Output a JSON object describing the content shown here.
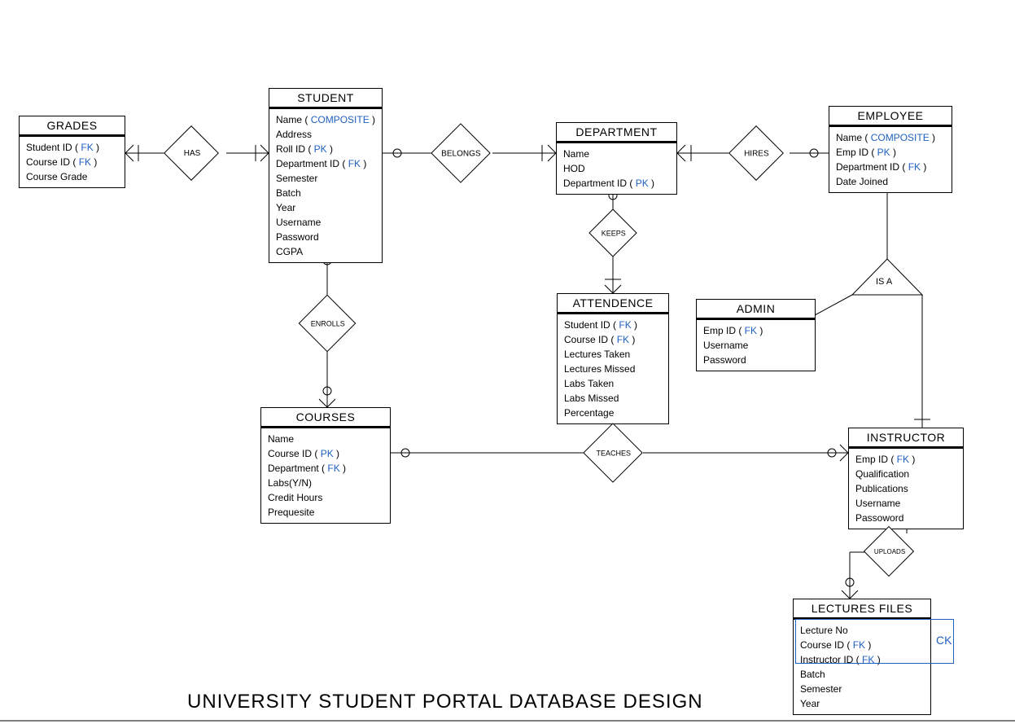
{
  "title": "UNIVERSITY STUDENT PORTAL DATABASE DESIGN",
  "entities": {
    "grades": {
      "name": "GRADES",
      "attrs": [
        {
          "text": "Student ID ( ",
          "key": "FK",
          "suffix": " )"
        },
        {
          "text": "Course ID ( ",
          "key": "FK",
          "suffix": " )"
        },
        {
          "text": "Course Grade"
        }
      ]
    },
    "student": {
      "name": "STUDENT",
      "attrs": [
        {
          "text": "Name ( ",
          "key": "COMPOSITE",
          "suffix": " )"
        },
        {
          "text": "Address"
        },
        {
          "text": "Roll ID ( ",
          "key": "PK",
          "suffix": " )"
        },
        {
          "text": "Department ID ( ",
          "key": "FK",
          "suffix": " )"
        },
        {
          "text": "Semester"
        },
        {
          "text": "Batch"
        },
        {
          "text": "Year"
        },
        {
          "text": "Username"
        },
        {
          "text": "Password"
        },
        {
          "text": "CGPA"
        }
      ]
    },
    "department": {
      "name": "DEPARTMENT",
      "attrs": [
        {
          "text": "Name"
        },
        {
          "text": "HOD"
        },
        {
          "text": "Department ID ( ",
          "key": "PK",
          "suffix": " )"
        }
      ]
    },
    "employee": {
      "name": "EMPLOYEE",
      "attrs": [
        {
          "text": "Name ( ",
          "key": "COMPOSITE",
          "suffix": " )"
        },
        {
          "text": "Emp ID ( ",
          "key": "PK",
          "suffix": " )"
        },
        {
          "text": "Department ID ( ",
          "key": "FK",
          "suffix": " )"
        },
        {
          "text": "Date Joined"
        }
      ]
    },
    "attendence": {
      "name": "ATTENDENCE",
      "attrs": [
        {
          "text": "Student ID ( ",
          "key": "FK",
          "suffix": " )"
        },
        {
          "text": "Course ID ( ",
          "key": "FK",
          "suffix": " )"
        },
        {
          "text": "Lectures Taken"
        },
        {
          "text": "Lectures Missed"
        },
        {
          "text": "Labs Taken"
        },
        {
          "text": "Labs Missed"
        },
        {
          "text": "Percentage"
        }
      ]
    },
    "admin": {
      "name": "ADMIN",
      "attrs": [
        {
          "text": "Emp ID ( ",
          "key": "FK",
          "suffix": " )"
        },
        {
          "text": "Username"
        },
        {
          "text": "Password"
        }
      ]
    },
    "courses": {
      "name": "COURSES",
      "attrs": [
        {
          "text": "Name"
        },
        {
          "text": "Course ID ( ",
          "key": "PK",
          "suffix": " )"
        },
        {
          "text": "Department ( ",
          "key": "FK",
          "suffix": " )"
        },
        {
          "text": "Labs(Y/N)"
        },
        {
          "text": "Credit Hours"
        },
        {
          "text": "Prequesite"
        }
      ]
    },
    "instructor": {
      "name": "INSTRUCTOR",
      "attrs": [
        {
          "text": "Emp ID ( ",
          "key": "FK",
          "suffix": " )"
        },
        {
          "text": "Qualification"
        },
        {
          "text": "Publications"
        },
        {
          "text": "Username"
        },
        {
          "text": "Passoword"
        }
      ]
    },
    "lectures": {
      "name": "LECTURES FILES",
      "attrs": [
        {
          "text": "Lecture No"
        },
        {
          "text": "Course ID ( ",
          "key": "FK",
          "suffix": " )"
        },
        {
          "text": "Instructor ID ( ",
          "key": "FK",
          "suffix": " )"
        },
        {
          "text": "Batch"
        },
        {
          "text": "Semester"
        },
        {
          "text": "Year"
        }
      ]
    }
  },
  "relationships": {
    "has": "HAS",
    "belongs": "BELONGS",
    "hires": "HIRES",
    "keeps": "KEEPS",
    "enrolls": "ENROLLS",
    "teaches": "TEACHES",
    "isa": "IS A",
    "uploads": "UPLOADS"
  },
  "ck_label": "CK"
}
